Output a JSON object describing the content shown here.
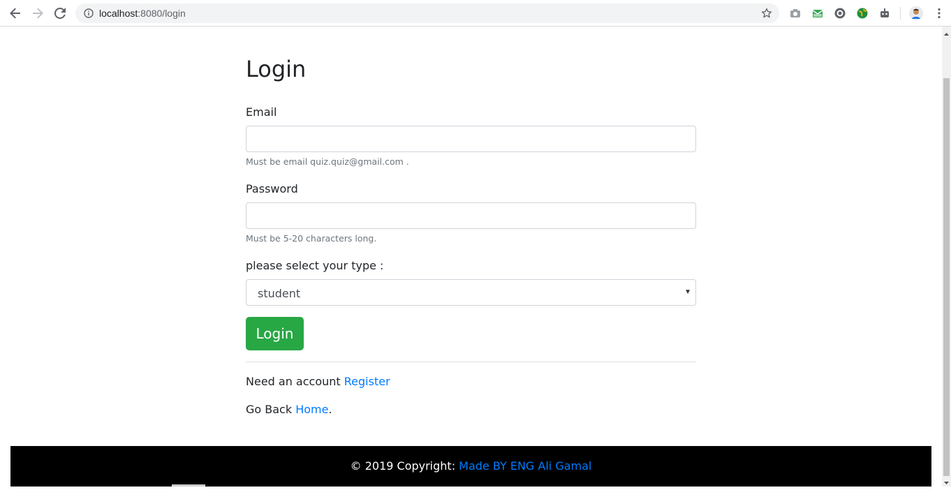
{
  "browser": {
    "url_host": "localhost",
    "url_rest": ":8080/login"
  },
  "page": {
    "title": "Login",
    "email": {
      "label": "Email",
      "value": "",
      "help": "Must be email quiz.quiz@gmail.com ."
    },
    "password": {
      "label": "Password",
      "value": "",
      "help": "Must be 5-20 characters long."
    },
    "type_select": {
      "label": "please select your type :",
      "selected": "student"
    },
    "login_button": "Login",
    "register_line": {
      "prefix": "Need an account ",
      "link": "Register"
    },
    "home_line": {
      "prefix": "Go Back ",
      "link": "Home",
      "suffix": "."
    }
  },
  "footer": {
    "prefix": "© 2019 Copyright: ",
    "link": "Made BY ENG Ali Gamal"
  },
  "colors": {
    "primary_link": "#007bff",
    "success_button": "#28a745",
    "footer_bg": "#000000"
  },
  "icons": [
    "back-arrow-icon",
    "forward-arrow-icon",
    "reload-icon",
    "info-icon",
    "star-icon",
    "camera-icon",
    "mail-icon",
    "circle-extension-icon",
    "globe-extension-icon",
    "robot-extension-icon",
    "profile-avatar",
    "menu-dots-icon"
  ]
}
